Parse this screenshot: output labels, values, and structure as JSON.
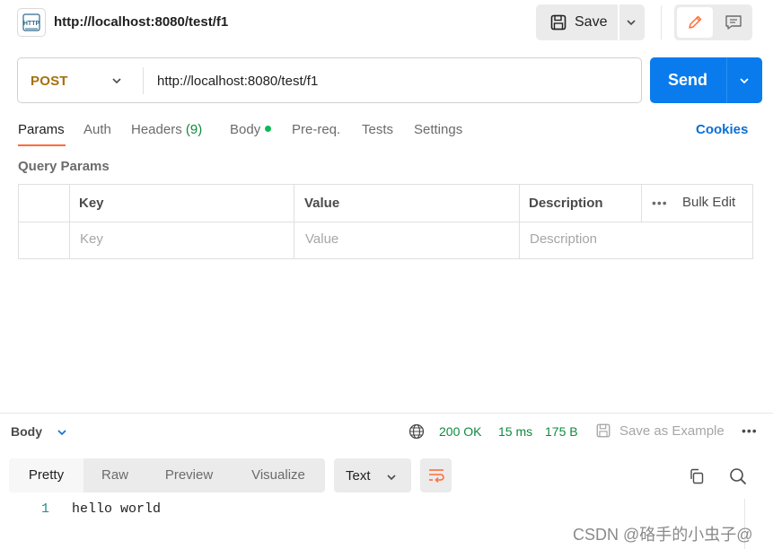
{
  "header": {
    "icon": "http-request-icon",
    "title": "http://localhost:8080/test/f1",
    "save_label": "Save"
  },
  "request": {
    "method": "POST",
    "url": "http://localhost:8080/test/f1",
    "send_label": "Send"
  },
  "tabs": {
    "params": "Params",
    "auth": "Auth",
    "headers": "Headers",
    "headers_count": "(9)",
    "body": "Body",
    "prereq": "Pre-req.",
    "tests": "Tests",
    "settings": "Settings",
    "cookies": "Cookies"
  },
  "query_params": {
    "title": "Query Params",
    "columns": [
      "Key",
      "Value",
      "Description"
    ],
    "bulk_edit": "Bulk Edit",
    "more": "•••",
    "placeholders": {
      "key": "Key",
      "value": "Value",
      "description": "Description"
    }
  },
  "response": {
    "body_label": "Body",
    "status": "200 OK",
    "time": "15 ms",
    "size": "175 B",
    "save_example": "Save as Example",
    "more": "•••",
    "views": [
      "Pretty",
      "Raw",
      "Preview",
      "Visualize"
    ],
    "format": "Text",
    "lines": [
      {
        "no": "1",
        "text": "hello world"
      }
    ]
  },
  "watermark": "CSDN @硌手的小虫子@",
  "colors": {
    "accent_orange": "#ff6c37",
    "send_blue": "#097bed",
    "method_post": "#a6700e",
    "status_green": "#0f8a3e",
    "link_blue": "#0b6fd3"
  }
}
